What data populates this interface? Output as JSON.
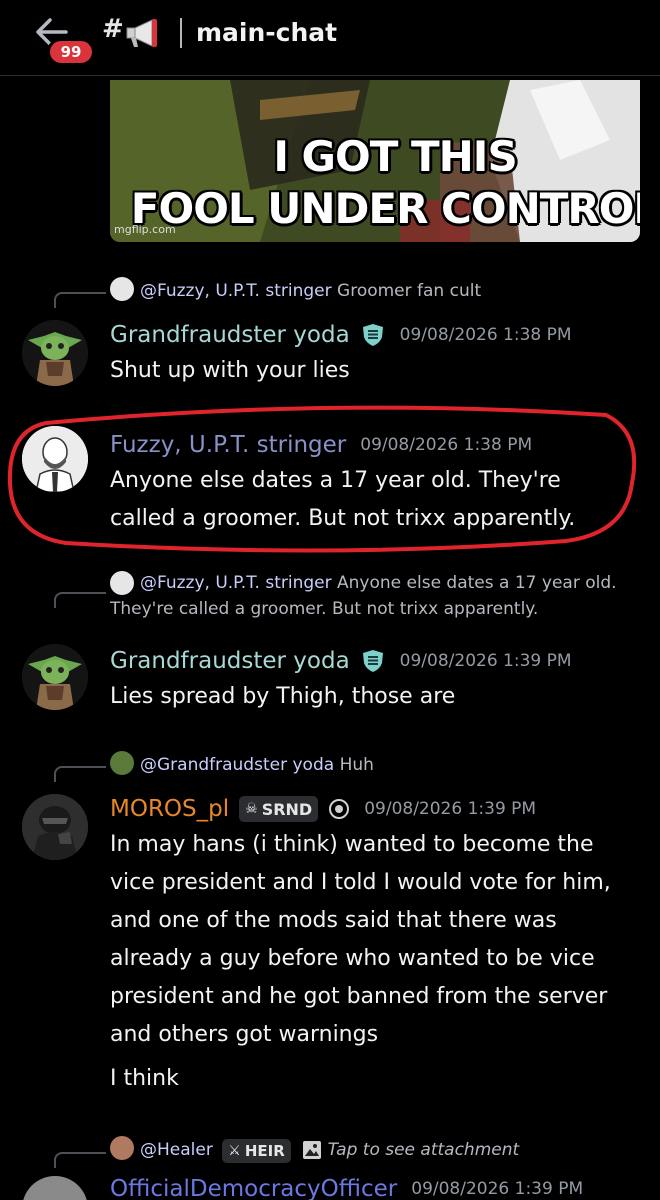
{
  "header": {
    "unread_badge": "99",
    "hash": "#",
    "channel_name": "main-chat"
  },
  "meme": {
    "line1": "I GOT THIS",
    "line2": "FOOL UNDER CONTROL",
    "watermark": "mgflip.com"
  },
  "messages": [
    {
      "reply_mention": "@Fuzzy, U.P.T. stringer",
      "reply_text": "Groomer fan cult",
      "username": "Grandfraudster yoda",
      "timestamp": "09/08/2026 1:38 PM",
      "text": "Shut up with your lies",
      "name_color": "#a8d8d4"
    },
    {
      "username": "Fuzzy, U.P.T. stringer",
      "timestamp": "09/08/2026 1:38 PM",
      "text_line1": "Anyone else dates a 17 year old. They're",
      "text_line2": "called a groomer. But not trixx apparently.",
      "name_color": "#8a90c8"
    },
    {
      "reply_mention": "@Fuzzy, U.P.T. stringer",
      "reply_text_line1": "Anyone else dates a 17 year old.",
      "reply_text_line2": "They're called a groomer. But not trixx apparently.",
      "username": "Grandfraudster yoda",
      "timestamp": "09/08/2026 1:39 PM",
      "text": "Lies spread by Thigh, those are",
      "name_color": "#a8d8d4"
    },
    {
      "reply_mention": "@Grandfraudster yoda",
      "reply_text": "Huh",
      "username": "MOROS_pl",
      "tag": "SRND",
      "timestamp": "09/08/2026 1:39 PM",
      "text_lines": [
        "In may hans (i think) wanted to become the",
        "vice president and I told I would vote for him,",
        "and one of the mods said that there was",
        "already a guy before who wanted to be vice",
        "president and he got banned from the server",
        "and others got warnings"
      ],
      "text_extra": "I think",
      "name_color": "#e8872a"
    },
    {
      "reply_mention": "@Healer",
      "reply_tag": "HEIR",
      "reply_text": "Tap to see attachment",
      "username": "OfficialDemocracyOfficer",
      "timestamp": "09/08/2026 1:39 PM",
      "name_color": "#6b78e0"
    }
  ],
  "colors": {
    "background": "#000000",
    "highlight": "#e0242c",
    "badge": "#d9343b"
  }
}
